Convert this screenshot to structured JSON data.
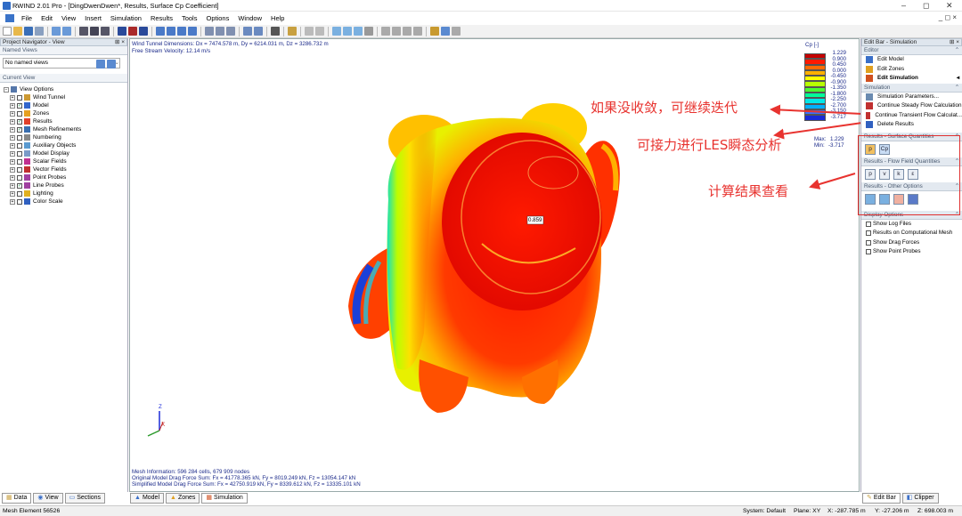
{
  "window": {
    "title": "RWIND 2.01 Pro - [DingDwenDwen*, Results, Surface Cp Coefficient]",
    "min": "–",
    "restore": "◻",
    "close": "✕",
    "mdi_controls": "_ ◻ ×"
  },
  "menu": [
    "File",
    "Edit",
    "View",
    "Insert",
    "Simulation",
    "Results",
    "Tools",
    "Options",
    "Window",
    "Help"
  ],
  "navigator": {
    "title": "Project Navigator - View",
    "named_views_header": "Named Views",
    "named_views_value": "No named views",
    "current_view_header": "Current View",
    "tree": [
      {
        "label": "View Options",
        "indent": 0,
        "check": false,
        "icon": "view-icon",
        "color": "#5577aa"
      },
      {
        "label": "Wind Tunnel",
        "indent": 1,
        "check": false,
        "icon": "tunnel-icon",
        "color": "#cc9933"
      },
      {
        "label": "Model",
        "indent": 1,
        "check": true,
        "icon": "model-icon",
        "color": "#3366cc"
      },
      {
        "label": "Zones",
        "indent": 1,
        "check": false,
        "icon": "zones-icon",
        "color": "#e6a020"
      },
      {
        "label": "Results",
        "indent": 1,
        "check": true,
        "icon": "results-icon",
        "color": "#e0402a"
      },
      {
        "label": "Mesh Refinements",
        "indent": 1,
        "check": true,
        "icon": "mesh-icon",
        "color": "#3a6fb0"
      },
      {
        "label": "Numbering",
        "indent": 1,
        "check": false,
        "icon": "numbering-icon",
        "color": "#888888"
      },
      {
        "label": "Auxiliary Objects",
        "indent": 1,
        "check": false,
        "icon": "aux-icon",
        "color": "#5a9ad0"
      },
      {
        "label": "Model Display",
        "indent": 1,
        "check": false,
        "icon": "display-icon",
        "color": "#7a9ac8"
      },
      {
        "label": "Scalar Fields",
        "indent": 1,
        "check": false,
        "icon": "scalar-icon",
        "color": "#c03090"
      },
      {
        "label": "Vector Fields",
        "indent": 1,
        "check": false,
        "icon": "vector-icon",
        "color": "#c03030"
      },
      {
        "label": "Point Probes",
        "indent": 1,
        "check": false,
        "icon": "probe-icon",
        "color": "#a040a0"
      },
      {
        "label": "Line Probes",
        "indent": 1,
        "check": true,
        "icon": "lineprobe-icon",
        "color": "#a040a0"
      },
      {
        "label": "Lighting",
        "indent": 1,
        "check": false,
        "icon": "light-icon",
        "color": "#e0b020"
      },
      {
        "label": "Color Scale",
        "indent": 1,
        "check": false,
        "icon": "colorscale-icon",
        "color": "#3060c0"
      }
    ]
  },
  "viewport": {
    "line1": "Wind Tunnel Dimensions: Dx = 7474.578 m, Dy = 6214.031 m, Dz = 3286.732 m",
    "line2": "Free Stream Velocity: 12.14 m/s",
    "legend_title": "Cp [-]",
    "legend_values": [
      "1.229",
      "0.900",
      "0.450",
      "0.000",
      "-0.450",
      "-0.900",
      "-1.350",
      "-1.800",
      "-2.250",
      "-2.700",
      "-3.150",
      "-3.717"
    ],
    "legend_colors": [
      "#c40000",
      "#ff1a00",
      "#ff6a00",
      "#ffb000",
      "#ffff00",
      "#b8ff00",
      "#4cff30",
      "#00ff9a",
      "#00e8e8",
      "#00b0ff",
      "#3a70ff",
      "#1a2ad8"
    ],
    "max_label": "Max:",
    "max_value": "1.229",
    "min_label": "Min:",
    "min_value": "-3.717",
    "probe_value": "0.859",
    "axis_z": "Z",
    "axis_x": "X",
    "mesh_info": "Mesh Information: 596 284 cells, 679 909 nodes",
    "orig_drag": "Original Model Drag Force Sum: Fx = 41778.365 kN, Fy = 8019.249 kN, Fz = 13054.147 kN",
    "simp_drag": "Simplified Model Drag Force Sum: Fx = 42750.919 kN, Fy = 8339.612 kN, Fz = 13335.101 kN"
  },
  "annotations": {
    "a1": "如果没收敛，可继续迭代",
    "a2": "可接力进行LES瞬态分析",
    "a3": "计算结果查看",
    "color": "#e8332f"
  },
  "editbar": {
    "title": "Edit Bar - Simulation",
    "editor_header": "Editor",
    "editor_items": [
      "Edit Model",
      "Edit Zones",
      "Edit Simulation"
    ],
    "simulation_header": "Simulation",
    "simulation_items": [
      "Simulation Parameters...",
      "Continue Steady Flow Calculation",
      "Continue Transient Flow Calculat...",
      "Delete Results"
    ],
    "surface_header": "Results - Surface Quantities",
    "surface_buttons": [
      "p",
      "Cp"
    ],
    "flow_header": "Results - Flow Field Quantities",
    "flow_buttons": [
      "p",
      "v",
      "k",
      "ε"
    ],
    "other_header": "Results - Other Options",
    "display_header": "Display Options",
    "display_items": [
      "Show Log Files",
      "Results on Computational Mesh",
      "Show Drag Forces",
      "Show Point Probes"
    ]
  },
  "bottom_left_tabs": [
    "Data",
    "View",
    "Sections"
  ],
  "bottom_mid_tabs": [
    "Model",
    "Zones",
    "Simulation"
  ],
  "bottom_right_tabs": [
    "Edit Bar",
    "Clipper"
  ],
  "status": {
    "left": "Mesh Element 56526",
    "system": "System: Default",
    "plane": "Plane: XY",
    "x": "X:  -287.785 m",
    "y": "Y:  -27.206 m",
    "z": "Z:  698.003 m"
  }
}
